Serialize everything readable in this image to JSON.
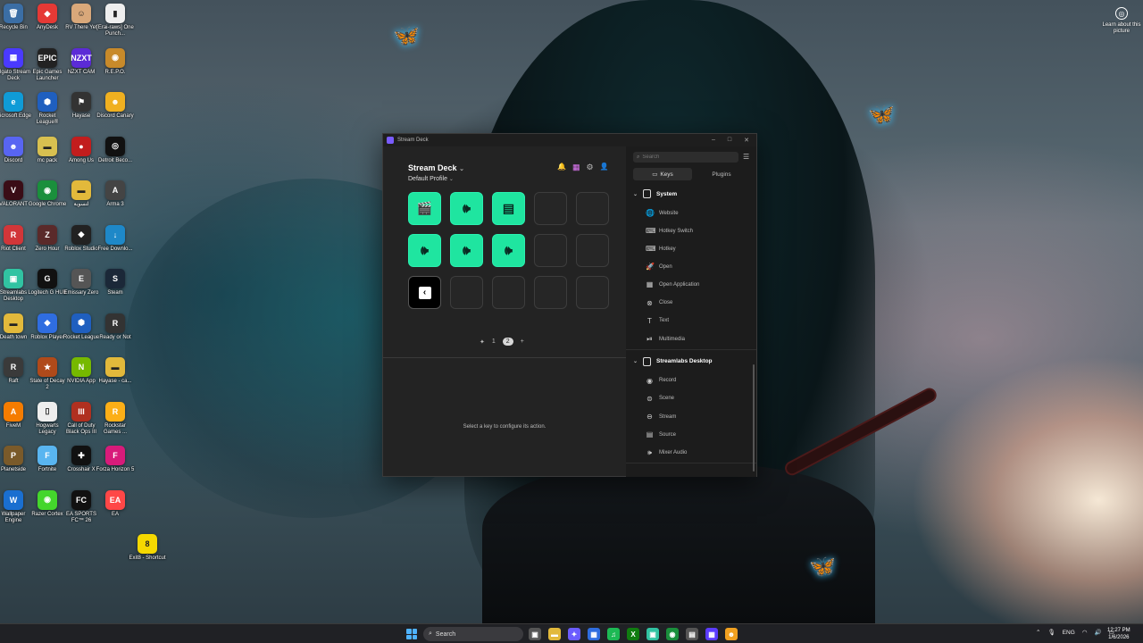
{
  "desktop": {
    "learn_about": "Learn about this picture",
    "icons": [
      {
        "label": "Recycle Bin",
        "glyph": "🗑",
        "color": "#3b6ea5"
      },
      {
        "label": "AnyDesk",
        "glyph": "◆",
        "color": "#e53935"
      },
      {
        "label": "RV There Yet",
        "glyph": "☺",
        "color": "#d9a87a"
      },
      {
        "label": "[Erai-raws] One Punch...",
        "glyph": "▮",
        "color": "#eeeeee"
      },
      {
        "label": "Elgato Stream Deck",
        "glyph": "▦",
        "color": "#4a3aff"
      },
      {
        "label": "Epic Games Launcher",
        "glyph": "EPIC",
        "color": "#222222"
      },
      {
        "label": "NZXT CAM",
        "glyph": "NZXT",
        "color": "#5b2bd6"
      },
      {
        "label": "R.E.P.O.",
        "glyph": "◉",
        "color": "#c88a2a"
      },
      {
        "label": "Microsoft Edge",
        "glyph": "e",
        "color": "#0f9bd7"
      },
      {
        "label": "Rocket League®",
        "glyph": "⬢",
        "color": "#1f5fbf"
      },
      {
        "label": "Hayase",
        "glyph": "⚑",
        "color": "#333333"
      },
      {
        "label": "Discord Canary",
        "glyph": "☻",
        "color": "#f0b020"
      },
      {
        "label": "Discord",
        "glyph": "☻",
        "color": "#5865f2"
      },
      {
        "label": "mc pack",
        "glyph": "▬",
        "color": "#d8c050"
      },
      {
        "label": "Among Us",
        "glyph": "●",
        "color": "#c21d1d"
      },
      {
        "label": "Detroit Beco...",
        "glyph": "◎",
        "color": "#111111"
      },
      {
        "label": "VALORANT",
        "glyph": "V",
        "color": "#3a0d16"
      },
      {
        "label": "Google Chrome",
        "glyph": "◉",
        "color": "#1a8f3c"
      },
      {
        "label": "لتسوية",
        "glyph": "▬",
        "color": "#e2b93b"
      },
      {
        "label": "Arma 3",
        "glyph": "A",
        "color": "#444444"
      },
      {
        "label": "Riot Client",
        "glyph": "R",
        "color": "#d13639"
      },
      {
        "label": "Zero Hour",
        "glyph": "Z",
        "color": "#5a2a2a"
      },
      {
        "label": "Roblox Studio",
        "glyph": "◆",
        "color": "#222222"
      },
      {
        "label": "Free Downlo...",
        "glyph": "↓",
        "color": "#1e88c8"
      },
      {
        "label": "Streamlabs Desktop",
        "glyph": "▣",
        "color": "#31c3a2"
      },
      {
        "label": "Logitech G HUB",
        "glyph": "G",
        "color": "#111111"
      },
      {
        "label": "Emissary Zero",
        "glyph": "E",
        "color": "#555555"
      },
      {
        "label": "Steam",
        "glyph": "S",
        "color": "#1b2838"
      },
      {
        "label": "Death town",
        "glyph": "▬",
        "color": "#e2b93b"
      },
      {
        "label": "Roblox Player",
        "glyph": "◆",
        "color": "#2f6de0"
      },
      {
        "label": "Rocket League",
        "glyph": "⬢",
        "color": "#1f5fbf"
      },
      {
        "label": "Ready or Not",
        "glyph": "R",
        "color": "#333333"
      },
      {
        "label": "Raft",
        "glyph": "R",
        "color": "#3a3a3a"
      },
      {
        "label": "State of Decay 2",
        "glyph": "★",
        "color": "#b04a1a"
      },
      {
        "label": "NVIDIA App",
        "glyph": "N",
        "color": "#76b900"
      },
      {
        "label": "Hayase - ca...",
        "glyph": "▬",
        "color": "#e2b93b"
      },
      {
        "label": "FiveM",
        "glyph": "A",
        "color": "#f57c00"
      },
      {
        "label": "Hogwarts Legacy",
        "glyph": "▯",
        "color": "#eeeeee"
      },
      {
        "label": "Call of Duty Black Ops III",
        "glyph": "III",
        "color": "#b03020"
      },
      {
        "label": "Rockstar Games ...",
        "glyph": "R",
        "color": "#fcaf17"
      },
      {
        "label": "Planetside",
        "glyph": "P",
        "color": "#7a5a2a"
      },
      {
        "label": "Fortnite",
        "glyph": "F",
        "color": "#59b5f0"
      },
      {
        "label": "Crosshair X",
        "glyph": "✚",
        "color": "#111111"
      },
      {
        "label": "Forza Horizon 5",
        "glyph": "F",
        "color": "#d81b7a"
      },
      {
        "label": "Wallpaper Engine",
        "glyph": "W",
        "color": "#1a6fd0"
      },
      {
        "label": "Razer Cortex",
        "glyph": "◉",
        "color": "#44d62c"
      },
      {
        "label": "EA SPORTS FC™ 26",
        "glyph": "FC",
        "color": "#111111"
      },
      {
        "label": "EA",
        "glyph": "EA",
        "color": "#ff4747"
      },
      {
        "label": "Exit8 - Shortcut",
        "glyph": "8",
        "color": "#f5d800"
      }
    ]
  },
  "window": {
    "title": "Stream Deck",
    "controls": {
      "minimize": "–",
      "maximize": "□",
      "close": "✕"
    },
    "device": "Stream Deck",
    "device_chevron": "⌄",
    "profile": "Default Profile",
    "profile_chevron": "⌄",
    "header_icons": {
      "bell": "🔔",
      "store": "▦",
      "settings": "⚙",
      "account": "👤"
    },
    "keys": [
      {
        "state": "green",
        "glyph": "🎬"
      },
      {
        "state": "green",
        "glyph": "🕪"
      },
      {
        "state": "green",
        "glyph": "▤"
      },
      {
        "state": "empty",
        "glyph": ""
      },
      {
        "state": "empty",
        "glyph": ""
      },
      {
        "state": "green",
        "glyph": "🕪"
      },
      {
        "state": "green",
        "glyph": "🕪"
      },
      {
        "state": "green",
        "glyph": "🕪"
      },
      {
        "state": "empty",
        "glyph": ""
      },
      {
        "state": "empty",
        "glyph": ""
      },
      {
        "state": "black",
        "glyph": "‹"
      },
      {
        "state": "empty",
        "glyph": ""
      },
      {
        "state": "empty",
        "glyph": ""
      },
      {
        "state": "empty",
        "glyph": ""
      },
      {
        "state": "empty",
        "glyph": ""
      }
    ],
    "pager": {
      "pin": "✦",
      "page1": "1",
      "page2": "2",
      "add": "+"
    },
    "config_hint": "Select a key to configure its action.",
    "sidebar": {
      "search_placeholder": "Search",
      "search_icon": "⌕",
      "list_icon": "☰",
      "tabs": [
        {
          "label": "Keys",
          "icon": "▭"
        },
        {
          "label": "Plugins",
          "icon": ""
        }
      ],
      "sections": [
        {
          "title": "System",
          "chevron": "⌄",
          "items": [
            {
              "label": "Website",
              "icon": "🌐"
            },
            {
              "label": "Hotkey Switch",
              "icon": "⌨"
            },
            {
              "label": "Hotkey",
              "icon": "⌨"
            },
            {
              "label": "Open",
              "icon": "🚀"
            },
            {
              "label": "Open Application",
              "icon": "▦"
            },
            {
              "label": "Close",
              "icon": "⊗"
            },
            {
              "label": "Text",
              "icon": "T"
            },
            {
              "label": "Multimedia",
              "icon": "⏯"
            }
          ]
        },
        {
          "title": "Streamlabs Desktop",
          "chevron": "⌄",
          "items": [
            {
              "label": "Record",
              "icon": "◉"
            },
            {
              "label": "Scene",
              "icon": "⊜"
            },
            {
              "label": "Stream",
              "icon": "⊖"
            },
            {
              "label": "Source",
              "icon": "▤"
            },
            {
              "label": "Mixer Audio",
              "icon": "🕪"
            }
          ]
        }
      ]
    }
  },
  "taskbar": {
    "search_placeholder": "Search",
    "search_icon": "⌕",
    "apps": [
      {
        "name": "task-view",
        "glyph": "▣",
        "color": "#555"
      },
      {
        "name": "file-explorer",
        "glyph": "▬",
        "color": "#e2b93b"
      },
      {
        "name": "copilot",
        "glyph": "✦",
        "color": "#6b5cff"
      },
      {
        "name": "photos",
        "glyph": "▦",
        "color": "#2f6de0"
      },
      {
        "name": "spotify",
        "glyph": "♫",
        "color": "#1db954"
      },
      {
        "name": "xbox",
        "glyph": "X",
        "color": "#107c10"
      },
      {
        "name": "streamlabs",
        "glyph": "▣",
        "color": "#31c3a2"
      },
      {
        "name": "chrome",
        "glyph": "◉",
        "color": "#1a8f3c"
      },
      {
        "name": "wallpaper",
        "glyph": "▤",
        "color": "#555"
      },
      {
        "name": "stream-deck",
        "glyph": "▦",
        "color": "#5b3cff"
      },
      {
        "name": "other",
        "glyph": "☻",
        "color": "#f0a020"
      }
    ],
    "tray": {
      "chevron": "⌃",
      "mic": "🎙",
      "lang": "ENG",
      "wifi": "◠",
      "volume": "🔊",
      "battery": "▭"
    },
    "time": "12:27 PM",
    "date": "1/6/2026"
  }
}
